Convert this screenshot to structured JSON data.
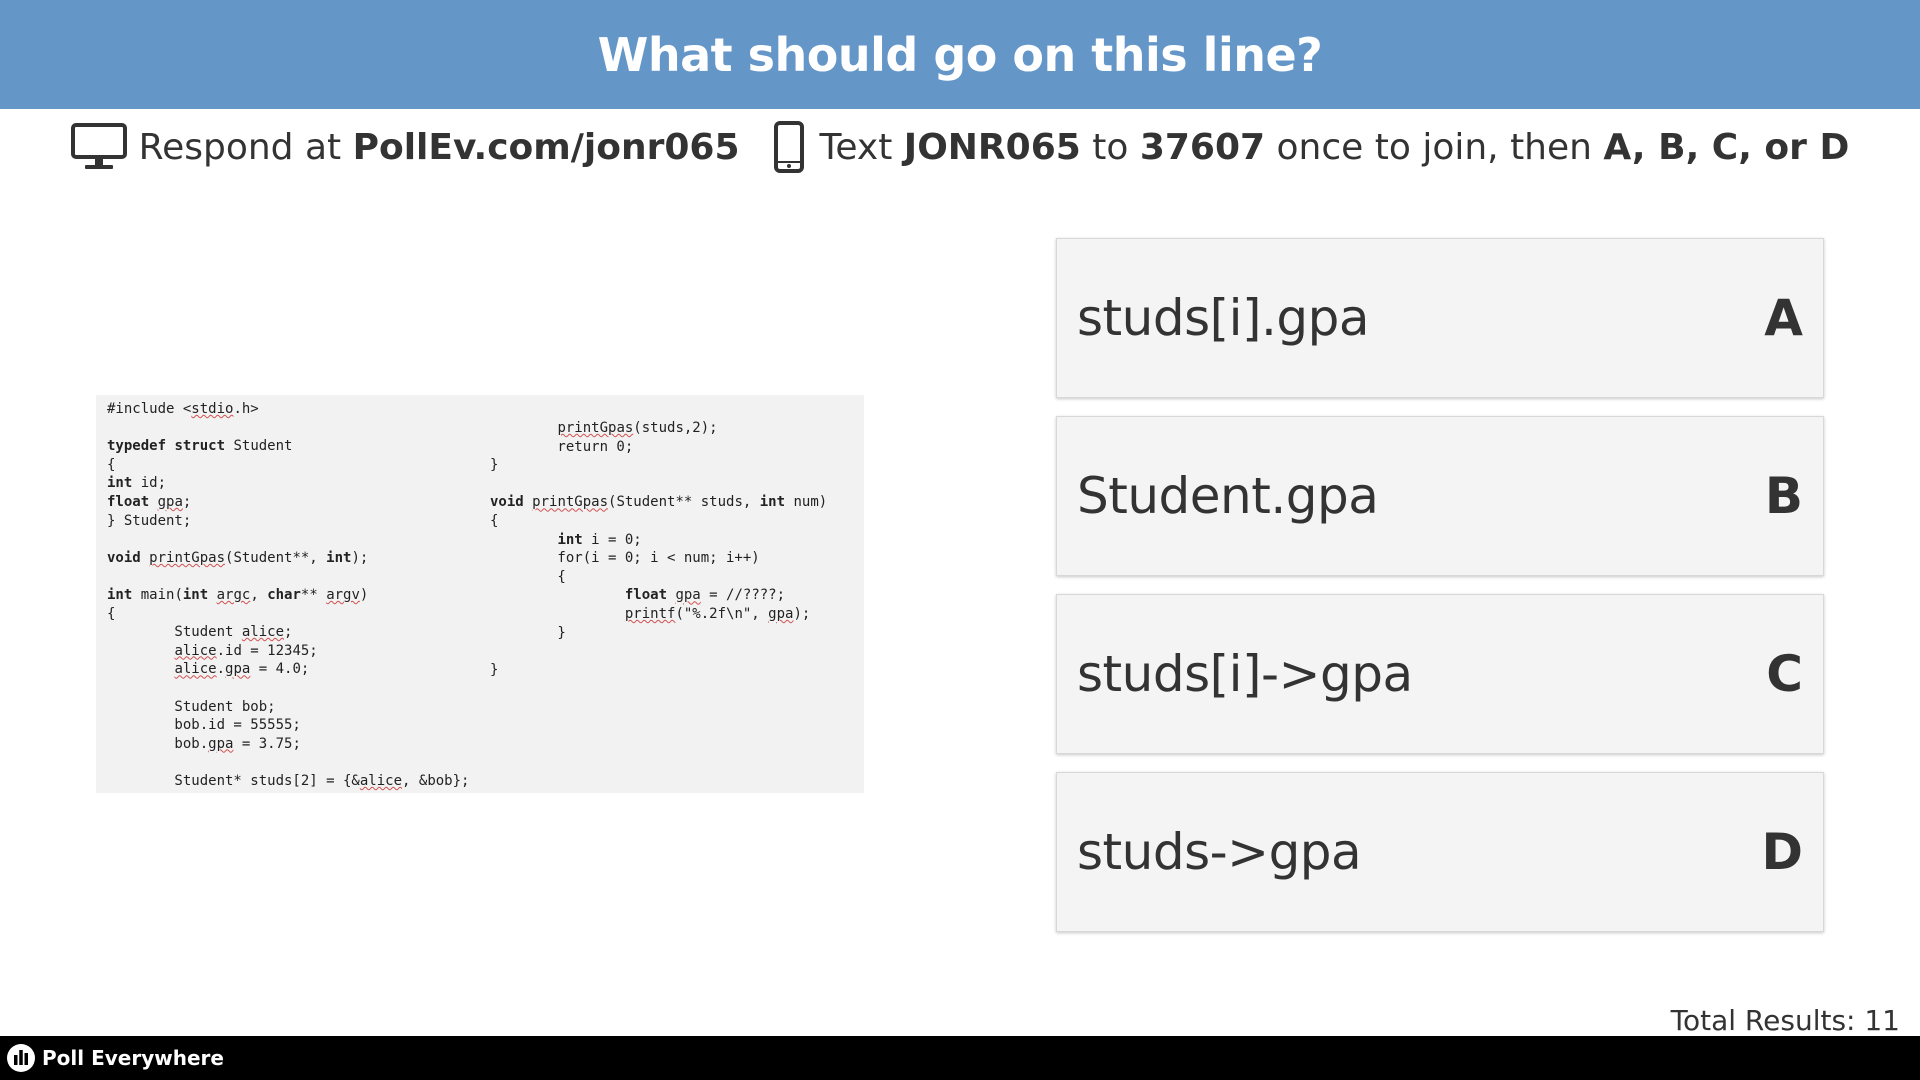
{
  "header": {
    "title": "What should go on this line?"
  },
  "instructions": {
    "monitor_icon": "monitor-icon",
    "respond_prefix": "Respond at ",
    "respond_url": "PollEv.com/jonr065",
    "phone_icon": "phone-icon",
    "text_prefix": "Text ",
    "code": "JONR065",
    "to_word": " to ",
    "number": "37607",
    "join_text": " once to join, then ",
    "choices": "A, B, C, or D"
  },
  "code": {
    "left_lines": [
      "#include <stdio.h>",
      "",
      "typedef struct Student",
      "{",
      "int id;",
      "float gpa;",
      "} Student;",
      "",
      "void printGpas(Student**, int);",
      "",
      "int main(int argc, char** argv)",
      "{",
      "        Student alice;",
      "        alice.id = 12345;",
      "        alice.gpa = 4.0;",
      "",
      "        Student bob;",
      "        bob.id = 55555;",
      "        bob.gpa = 3.75;",
      "",
      "        Student* studs[2] = {&alice, &bob};"
    ],
    "right_lines": [
      "        printGpas(studs,2);",
      "        return 0;",
      "}",
      "",
      "void printGpas(Student** studs, int num)",
      "{",
      "        int i = 0;",
      "        for(i = 0; i < num; i++)",
      "        {",
      "                float gpa = //????;",
      "                printf(\"%.2f\\n\", gpa);",
      "        }",
      "",
      "}"
    ]
  },
  "options": [
    {
      "text": "studs[i].gpa",
      "letter": "A"
    },
    {
      "text": "Student.gpa",
      "letter": "B"
    },
    {
      "text": "studs[i]->gpa",
      "letter": "C"
    },
    {
      "text": "studs->gpa",
      "letter": "D"
    }
  ],
  "results": {
    "total_label": "Total Results: 11"
  },
  "footer": {
    "logo_icon": "poll-everywhere-logo-icon",
    "brand": "Poll Everywhere"
  },
  "colors": {
    "header_bg": "#6496c8",
    "footer_bg": "#000000",
    "option_bg": "#f4f4f4",
    "code_bg": "#f2f2f2"
  }
}
